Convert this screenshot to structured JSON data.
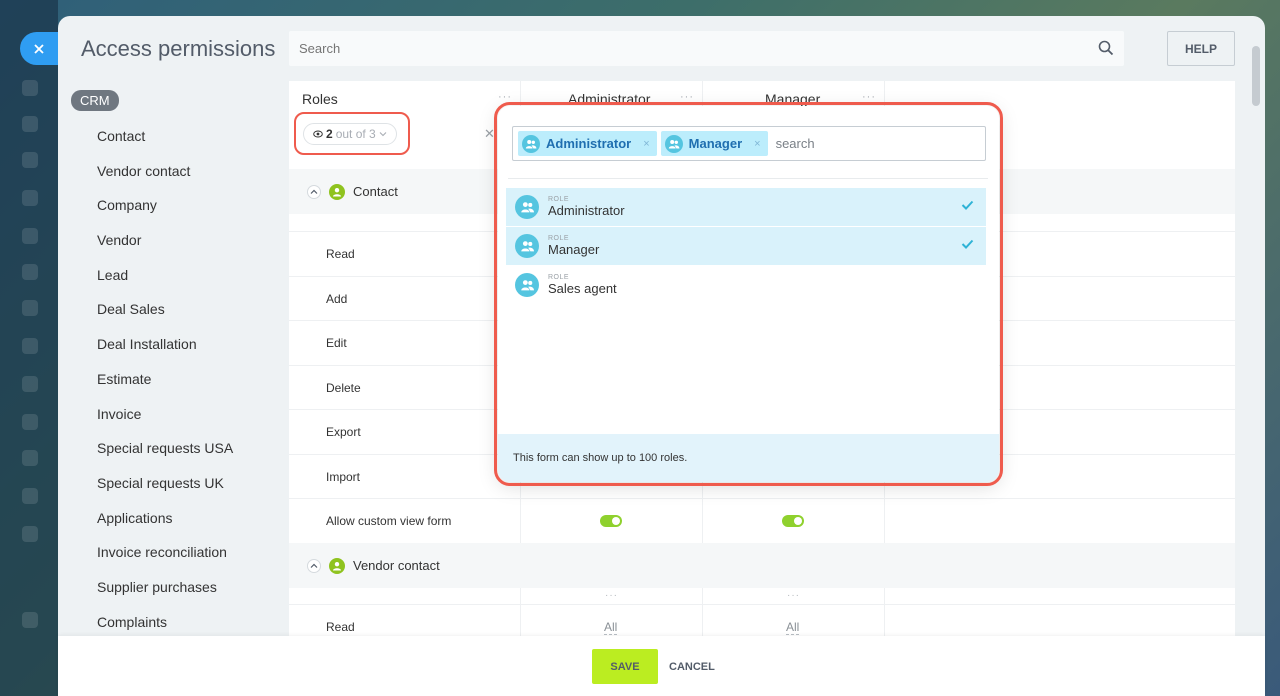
{
  "window": {
    "close_icon": "close-icon"
  },
  "header": {
    "title": "Access permissions",
    "search_placeholder": "Search",
    "help_label": "HELP"
  },
  "sidebar": {
    "badge": "CRM",
    "items": [
      {
        "label": "Contact"
      },
      {
        "label": "Vendor contact"
      },
      {
        "label": "Company"
      },
      {
        "label": "Vendor"
      },
      {
        "label": "Lead"
      },
      {
        "label": "Deal Sales"
      },
      {
        "label": "Deal Installation"
      },
      {
        "label": "Estimate"
      },
      {
        "label": "Invoice"
      },
      {
        "label": "Special requests USA"
      },
      {
        "label": "Special requests UK"
      },
      {
        "label": "Applications"
      },
      {
        "label": "Invoice reconciliation"
      },
      {
        "label": "Supplier purchases"
      },
      {
        "label": "Complaints"
      }
    ]
  },
  "table": {
    "roles_header": "Roles",
    "dots": "···",
    "columns": [
      {
        "label": "Administrator"
      },
      {
        "label": "Manager"
      }
    ],
    "filter": {
      "count": "2",
      "suffix": "out of 3",
      "clear": "✕"
    },
    "sections": [
      {
        "label": "Contact",
        "permissions": [
          {
            "label": "Read"
          },
          {
            "label": "Add"
          },
          {
            "label": "Edit"
          },
          {
            "label": "Delete"
          },
          {
            "label": "Export"
          },
          {
            "label": "Import"
          },
          {
            "label": "Allow custom view form",
            "admin_on": true,
            "manager_on": true
          }
        ]
      },
      {
        "label": "Vendor contact",
        "permissions": [
          {
            "label": "Read",
            "admin_value": "All",
            "manager_value": "All"
          }
        ]
      }
    ]
  },
  "role_selector": {
    "tags": [
      {
        "label": "Administrator",
        "remove": "×"
      },
      {
        "label": "Manager",
        "remove": "×"
      }
    ],
    "search_placeholder": "search",
    "items": [
      {
        "kind": "ROLE",
        "name": "Administrator",
        "selected": true
      },
      {
        "kind": "ROLE",
        "name": "Manager",
        "selected": true
      },
      {
        "kind": "ROLE",
        "name": "Sales agent",
        "selected": false
      }
    ],
    "footer_note": "This form can show up to 100 roles."
  },
  "footer": {
    "save_label": "SAVE",
    "cancel_label": "CANCEL"
  },
  "colors": {
    "accent": "#2f9df2",
    "highlight": "#ef5b4d",
    "save": "#bbed21",
    "toggle_on": "#8fd12e",
    "selected_row": "#d9f2fb"
  }
}
